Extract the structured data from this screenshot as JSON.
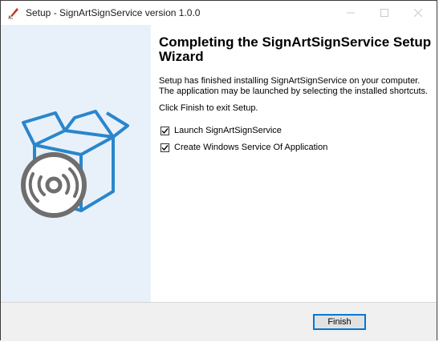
{
  "window": {
    "title": "Setup - SignArtSignService version 1.0.0",
    "controls": [
      "minimize",
      "maximize",
      "close"
    ]
  },
  "wizard": {
    "heading": "Completing the SignArtSignService Setup Wizard",
    "description": "Setup has finished installing SignArtSignService on your computer. The application may be launched by selecting the installed shortcuts.",
    "hint": "Click Finish to exit Setup.",
    "options": [
      {
        "label": "Launch SignArtSignService",
        "checked": true
      },
      {
        "label": "Create Windows Service Of Application",
        "checked": true
      }
    ]
  },
  "footer": {
    "finish_label": "Finish"
  },
  "colors": {
    "sidebar_bg": "#e8f1fa",
    "box_accent": "#2a86cc",
    "disc_gray": "#6e6e6e",
    "focus_border": "#0078d7"
  },
  "icons": {
    "app": "setup-pen-icon",
    "sidebar": "install-box-with-disc-icon"
  }
}
